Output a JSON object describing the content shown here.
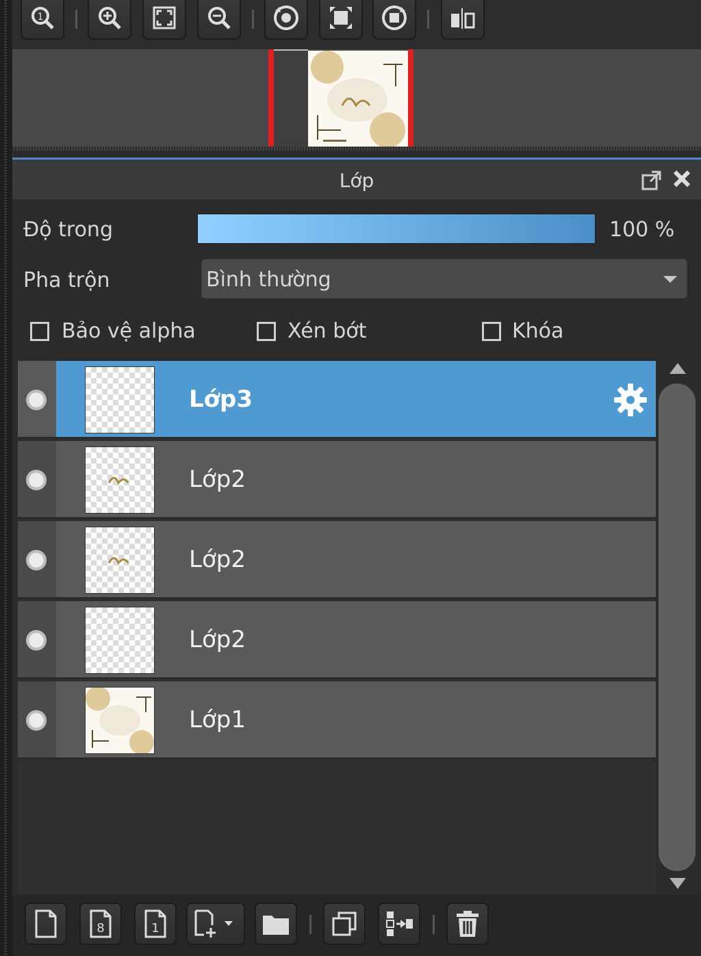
{
  "panel": {
    "title": "Lớp"
  },
  "opacity": {
    "label": "Độ trong",
    "value": "100 %",
    "fraction": 1.0
  },
  "blend": {
    "label": "Pha trộn",
    "value": "Bình thường"
  },
  "checkboxes": [
    {
      "label": "Bảo vệ alpha",
      "checked": false
    },
    {
      "label": "Xén bớt",
      "checked": false
    },
    {
      "label": "Khóa",
      "checked": false
    }
  ],
  "layers": [
    {
      "name": "Lớp3",
      "selected": true,
      "visible": true
    },
    {
      "name": "Lớp2",
      "selected": false,
      "visible": true
    },
    {
      "name": "Lớp2",
      "selected": false,
      "visible": true
    },
    {
      "name": "Lớp2",
      "selected": false,
      "visible": true
    },
    {
      "name": "Lớp1",
      "selected": false,
      "visible": true
    }
  ],
  "colors": {
    "accent": "#4f9ad2",
    "navigator_frame": "#e02020"
  }
}
